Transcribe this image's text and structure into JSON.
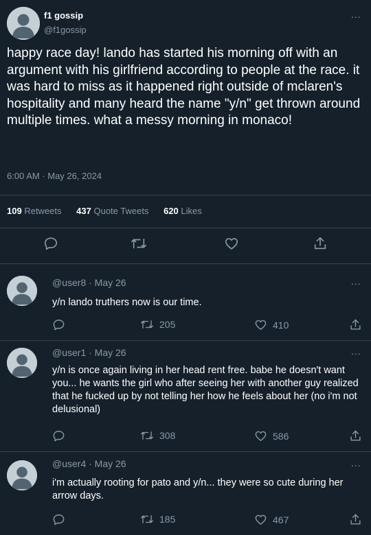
{
  "main": {
    "author_name": "f1 gossip",
    "author_handle": "@f1gossip",
    "more": "...",
    "text": "happy race day! lando has started his morning off with an argument with his girlfriend according to people at the race. it was hard to miss as it happened right outside of mclaren's hospitality and many heard the name \"y/n\" get thrown around multiple times. what a messy morning in monaco!",
    "timestamp": "6:00 AM · May 26, 2024",
    "stats": {
      "retweets_count": "109",
      "retweets_label": "Retweets",
      "quotes_count": "437",
      "quotes_label": "Quote Tweets",
      "likes_count": "620",
      "likes_label": "Likes"
    },
    "actions": [
      "reply-icon",
      "retweet-icon",
      "like-icon",
      "share-icon"
    ]
  },
  "replies": [
    {
      "meta": "@user8 · May 26",
      "text": "y/n lando truthers now is our time.",
      "retweets": "205",
      "likes": "410"
    },
    {
      "meta": "@user1 · May 26",
      "text": "y/n is once again living in her head rent free. babe he doesn't want you... he wants the girl who after seeing her with another guy realized that he fucked up by not telling her how he feels about her (no i'm not delusional)",
      "retweets": "308",
      "likes": "586"
    },
    {
      "meta": "@user4 · May 26",
      "text": "i'm actually rooting for pato and y/n... they were so cute during her arrow days.",
      "retweets": "185",
      "likes": "467"
    }
  ],
  "colors": {
    "background": "#15202b",
    "muted": "#8b98a5",
    "divider": "#38444d",
    "avatar": "#c4cfd6",
    "avatar_figure": "#536471"
  }
}
